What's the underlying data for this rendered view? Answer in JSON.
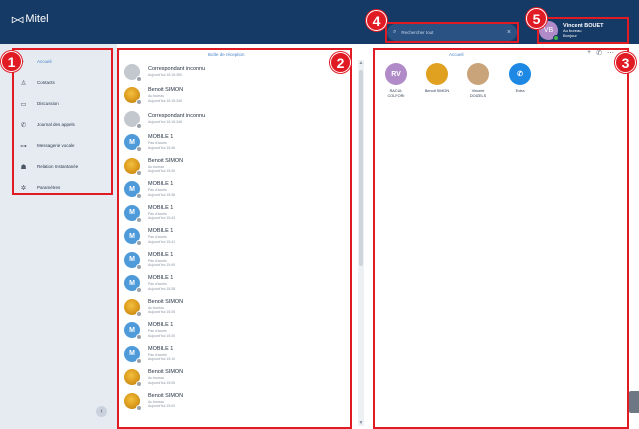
{
  "app": {
    "title": "Mitel",
    "logo_mark": "▷◁"
  },
  "search": {
    "placeholder": "Rechercher tout",
    "icon": "search-icon",
    "clear": "×"
  },
  "user": {
    "initials": "VB",
    "name": "Vincent BOUET",
    "status": "Au bureau",
    "note": "Bonjour"
  },
  "badges": [
    "1",
    "2",
    "3",
    "4",
    "5"
  ],
  "nav": [
    {
      "label": "Accueil",
      "icon": "home-icon",
      "glyph": "·",
      "active": true
    },
    {
      "label": "Contacts",
      "icon": "contacts-icon",
      "glyph": "♙"
    },
    {
      "label": "Discussion",
      "icon": "chat-icon",
      "glyph": "▭"
    },
    {
      "label": "Journal des appels",
      "icon": "call-log-icon",
      "glyph": "✆"
    },
    {
      "label": "Messagerie vocale",
      "icon": "voicemail-icon",
      "glyph": "⊶"
    },
    {
      "label": "Relation Instantanée",
      "icon": "instant-messaging-icon",
      "glyph": "☗"
    },
    {
      "label": "Paramètres",
      "icon": "settings-icon",
      "glyph": "✲"
    }
  ],
  "collapse_glyph": "‹",
  "inbox": {
    "title": "Boîte de réception",
    "items": [
      {
        "avatar": "unknown",
        "initial": "",
        "name": "Correspondant inconnu",
        "l1": "Aujourd'hui 16:15:350",
        "l2": ""
      },
      {
        "avatar": "photo",
        "initial": "",
        "name": "Benoit SIMON",
        "l1": "Au bureau",
        "l2": "Aujourd'hui 16:15:345"
      },
      {
        "avatar": "unknown",
        "initial": "",
        "name": "Correspondant inconnu",
        "l1": "Aujourd'hui 16:15:346",
        "l2": ""
      },
      {
        "avatar": "mobile",
        "initial": "M",
        "name": "MOBILE 1",
        "l1": "Pas d'accès",
        "l2": "Aujourd'hui 15:46"
      },
      {
        "avatar": "photo",
        "initial": "",
        "name": "Benoit SIMON",
        "l1": "Au bureau",
        "l2": "Aujourd'hui 15:40"
      },
      {
        "avatar": "mobile",
        "initial": "M",
        "name": "MOBILE 1",
        "l1": "Pas d'accès",
        "l2": "Aujourd'hui 15:38"
      },
      {
        "avatar": "mobile",
        "initial": "M",
        "name": "MOBILE 1",
        "l1": "Pas d'accès",
        "l2": "Aujourd'hui 15:43"
      },
      {
        "avatar": "mobile",
        "initial": "M",
        "name": "MOBILE 1",
        "l1": "Pas d'accès",
        "l2": "Aujourd'hui 15:41"
      },
      {
        "avatar": "mobile",
        "initial": "M",
        "name": "MOBILE 1",
        "l1": "Pas d'accès",
        "l2": "Aujourd'hui 15:40"
      },
      {
        "avatar": "mobile",
        "initial": "M",
        "name": "MOBILE 1",
        "l1": "Pas d'accès",
        "l2": "Aujourd'hui 15:38"
      },
      {
        "avatar": "photo",
        "initial": "",
        "name": "Benoit SIMON",
        "l1": "Au bureau",
        "l2": "Aujourd'hui 15:35"
      },
      {
        "avatar": "mobile",
        "initial": "M",
        "name": "MOBILE 1",
        "l1": "Pas d'accès",
        "l2": "Aujourd'hui 15:30"
      },
      {
        "avatar": "mobile",
        "initial": "M",
        "name": "MOBILE 1",
        "l1": "Pas d'accès",
        "l2": "Aujourd'hui 15:10"
      },
      {
        "avatar": "photo",
        "initial": "",
        "name": "Benoit SIMON",
        "l1": "Au bureau",
        "l2": "Aujourd'hui 15:05"
      },
      {
        "avatar": "photo",
        "initial": "",
        "name": "Benoit SIMON",
        "l1": "Au bureau",
        "l2": "Aujourd'hui 15:00"
      }
    ]
  },
  "scroll": {
    "up": "▲",
    "down": "▼"
  },
  "favorites": {
    "title": "Accueil",
    "actions": [
      "+",
      "✆",
      "⋯"
    ],
    "items": [
      {
        "name": "RACUL COLFORI",
        "avatar": "RV",
        "color": "#b08bc8",
        "icon": "contact-avatar-icon"
      },
      {
        "name": "Benoit SIMON",
        "avatar": "",
        "color": "#e0a020",
        "icon": "contact-photo-icon"
      },
      {
        "name": "Vincent DOIZELS",
        "avatar": "",
        "color": "#c9a37a",
        "icon": "contact-photo-icon"
      },
      {
        "name": "Extra",
        "avatar": "✆",
        "color": "#1e88e5",
        "icon": "phone-icon"
      }
    ]
  }
}
